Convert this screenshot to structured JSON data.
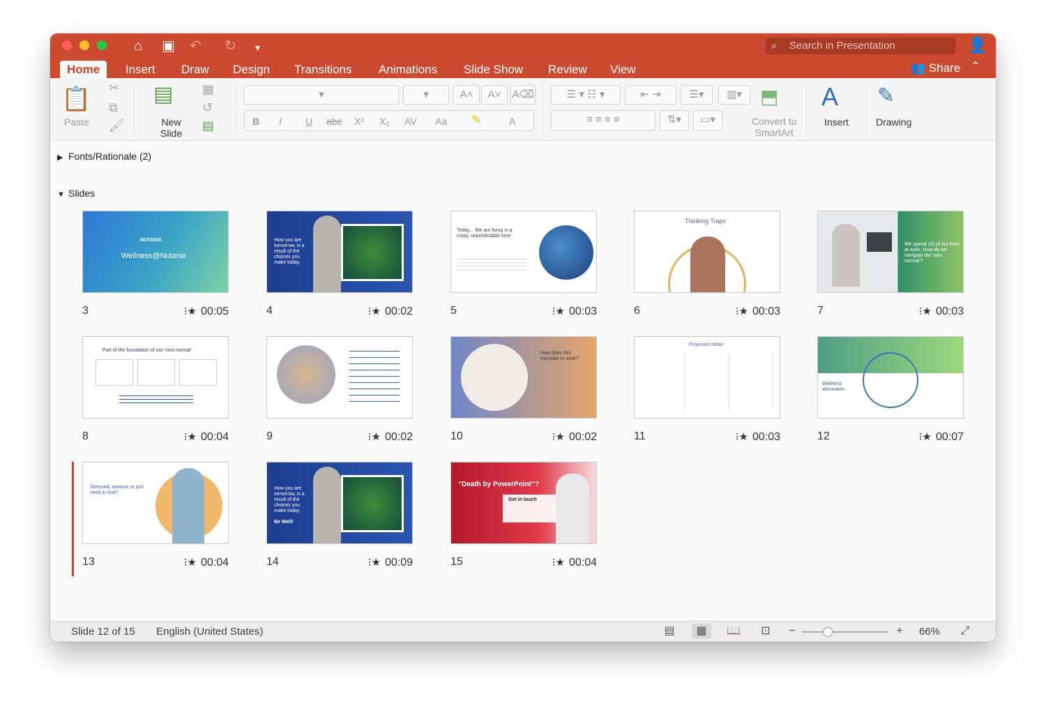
{
  "window": {
    "search_placeholder": "Search in Presentation",
    "quick_access": [
      "home-icon",
      "save-icon",
      "undo-icon",
      "redo-icon",
      "customize-icon"
    ]
  },
  "tabs": [
    "Home",
    "Insert",
    "Draw",
    "Design",
    "Transitions",
    "Animations",
    "Slide Show",
    "Review",
    "View"
  ],
  "active_tab": "Home",
  "share_label": "Share",
  "ribbon": {
    "paste": "Paste",
    "new_slide": "New\nSlide",
    "convert": "Convert to\nSmartArt",
    "insert": "Insert",
    "drawing": "Drawing",
    "font_buttons": [
      "B",
      "I",
      "U",
      "abc",
      "X²",
      "X₂",
      "AV",
      "Aa",
      "A"
    ]
  },
  "sections": [
    {
      "name": "Fonts/Rationale (2)",
      "expanded": false
    },
    {
      "name": "Slides",
      "expanded": true
    }
  ],
  "slides": [
    {
      "number": "3",
      "time": "00:05",
      "title": "Wellness@Nutanix",
      "brand": "NUTANIX"
    },
    {
      "number": "4",
      "time": "00:02",
      "text": "How you are tomorrow, is a result of the choices you make today."
    },
    {
      "number": "5",
      "time": "00:03",
      "text": "Today... We are living in a crazy, unpredictable time"
    },
    {
      "number": "6",
      "time": "00:03",
      "title": "Thinking Traps"
    },
    {
      "number": "7",
      "time": "00:03",
      "text": "We spend 1/3 of our lives at work. How do we navigate the 'new normal'?"
    },
    {
      "number": "8",
      "time": "00:04",
      "title": "Part of the foundation of our 'new normal'"
    },
    {
      "number": "9",
      "time": "00:02"
    },
    {
      "number": "10",
      "time": "00:02",
      "title": "How does this translate to work?"
    },
    {
      "number": "11",
      "time": "00:03",
      "title": "Proposed Ideas"
    },
    {
      "number": "12",
      "time": "00:07",
      "text": "Wellness advocates"
    },
    {
      "number": "13",
      "time": "00:04",
      "text": "Stressed, anxious or just need a chat?"
    },
    {
      "number": "14",
      "time": "00:09",
      "text": "How you are tomorrow, is a result of the choices you make today.",
      "cta": "Be Well!"
    },
    {
      "number": "15",
      "time": "00:04",
      "title": "“Death by PowerPoint”?",
      "sub": "Get in touch"
    }
  ],
  "status": {
    "slide_indicator": "Slide 12 of 15",
    "language": "English (United States)",
    "zoom": "66%",
    "zoom_fraction": 0.3
  },
  "colors": {
    "accent": "#cc4a2f",
    "selection": "#c6442b"
  }
}
